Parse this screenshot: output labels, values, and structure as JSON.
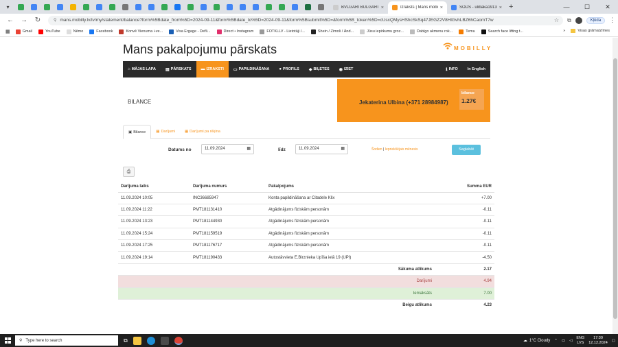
{
  "browser": {
    "tabs": [
      {
        "label": "BVLGARI BULGARI Tir",
        "active": false,
        "color": "#f0f0f0"
      },
      {
        "label": "Izraksts | Mans mobi",
        "active": true,
        "color": "#f7941d"
      },
      {
        "label": "SODS - ulibaka1913",
        "active": false,
        "color": "#4285f4"
      }
    ],
    "url": "mans.mobilly.lv/lv/my/statement/balance?form%5Bdate_from%5D=2024-09-11&form%5Bdate_to%5D=2024-09-11&form%5Bsubmit%5D=&form%5B_token%5D=cUsxQMysHShcSkSq47JEGZ2V8HlGvhLBZ6hCaomT7w",
    "profile_label": "Kļūda",
    "bookmarks": [
      "Gmail",
      "YouTube",
      "Nēmo",
      "Facebook",
      "Konvē Vienuma i-ve...",
      "Visa Ergage - Defli...",
      "Direct • Instagram",
      "FOTKLLV - Lietotāji /...",
      "Shein / Zimoli / Ānd...",
      "Jūsu iepirkumu groz...",
      "Dablgo akmenu rok...",
      "Temu",
      "Search face lifting t..."
    ],
    "bookmarks_all": "Visas grāmatzīmes"
  },
  "page": {
    "title": "Mans pakalpojumu pārskats",
    "brand": "MOBILLY",
    "nav": [
      {
        "label": "MĀJAS LAPA",
        "icon": "home-icon",
        "glyph": "⌂",
        "active": false
      },
      {
        "label": "PĀRSKATS",
        "icon": "list-icon",
        "glyph": "▤",
        "active": false
      },
      {
        "label": "IZRAKSTI",
        "icon": "folder-icon",
        "glyph": "▬",
        "active": true
      },
      {
        "label": "PAPILDINĀŠANA",
        "icon": "card-icon",
        "glyph": "▭",
        "active": false
      },
      {
        "label": "PROFILS",
        "icon": "user-icon",
        "glyph": "●",
        "active": false
      },
      {
        "label": "BIĻETES",
        "icon": "ticket-icon",
        "glyph": "◆",
        "active": false
      },
      {
        "label": "IZIET",
        "icon": "exit-icon",
        "glyph": "◉",
        "active": false
      }
    ],
    "nav_right": [
      {
        "label": "INFO",
        "glyph": "ℹ"
      },
      {
        "label": "In English",
        "glyph": ""
      }
    ],
    "balance_label": "BILANCE",
    "user": "Jekaterina Ulbina (+371 28984987)",
    "balance_box_label": "bilance",
    "balance_value": "1.27€",
    "subtabs": [
      {
        "label": "Bilance",
        "glyph": "▣",
        "active": true
      },
      {
        "label": "Darījumi",
        "glyph": "▦",
        "active": false
      },
      {
        "label": "Darījumi pa rēķina",
        "glyph": "▦",
        "active": false
      }
    ],
    "filter": {
      "from_label": "Datums no",
      "from_value": "11.09.2024",
      "to_label": "līdz",
      "to_value": "11.09.2024",
      "link_today": "Šodien",
      "link_prev": "Iepriekšējais mēnesis",
      "submit": "Saglabāt"
    },
    "table": {
      "headers": [
        "Darījuma laiks",
        "Darījuma numurs",
        "Pakalpojums",
        "Summa EUR"
      ],
      "rows": [
        [
          "11.09.2024 10:05",
          "INC36685947",
          "Konta papildināšana ar Citadele Klix",
          "+7.00"
        ],
        [
          "11.09.2024 11:22",
          "PMT181131410",
          "Atgādinājums fiziskām personām",
          "-0.11"
        ],
        [
          "11.09.2024 13:23",
          "PMT181144930",
          "Atgādinājums fiziskām personām",
          "-0.11"
        ],
        [
          "11.09.2024 15:24",
          "PMT181159519",
          "Atgādinājums fiziskām personām",
          "-0.11"
        ],
        [
          "11.09.2024 17:25",
          "PMT181176717",
          "Atgādinājums fiziskām personām",
          "-0.11"
        ],
        [
          "11.09.2024 19:14",
          "PMT181190433",
          "Autostāvvieta E.Birznieka Upīša ielā 19 (UPI)",
          "-4.50"
        ]
      ],
      "start_label": "Sākuma atlikums",
      "start_value": "2.17",
      "spent_label": "Darījumi",
      "spent_value": "4.94",
      "paid_label": "Iemaksāts",
      "paid_value": "7.00",
      "end_label": "Beigu atlikums",
      "end_value": "4.23"
    }
  },
  "taskbar": {
    "search_placeholder": "Type here to search",
    "weather": "1°C  Cloudy",
    "lang_top": "ENG",
    "lang_bottom": "LVS",
    "time": "17:30",
    "date": "12.12.2024"
  }
}
